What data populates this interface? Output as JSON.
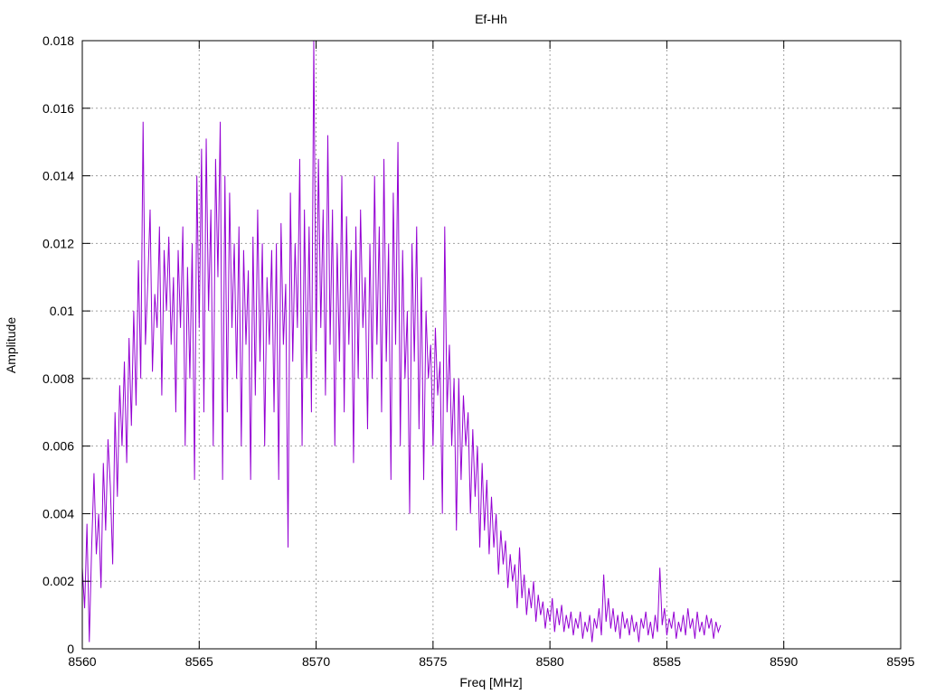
{
  "chart_data": {
    "type": "line",
    "title": "Ef-Hh",
    "xlabel": "Freq [MHz]",
    "ylabel": "Amplitude",
    "xlim": [
      8560,
      8595
    ],
    "ylim": [
      0,
      0.018
    ],
    "x_ticks": [
      "8560",
      "8565",
      "8570",
      "8575",
      "8580",
      "8585",
      "8590",
      "8595"
    ],
    "y_ticks": [
      "0",
      "0.002",
      "0.004",
      "0.006",
      "0.008",
      "0.01",
      "0.012",
      "0.014",
      "0.016",
      "0.018"
    ],
    "grid": true,
    "line_color": "#9400d3",
    "series": [
      {
        "x_start": 8560.0,
        "x_step": 0.1,
        "values": [
          0.0024,
          0.0012,
          0.0037,
          0.0002,
          0.003,
          0.0052,
          0.0028,
          0.004,
          0.0018,
          0.0055,
          0.0035,
          0.0062,
          0.0048,
          0.0025,
          0.007,
          0.0045,
          0.0078,
          0.006,
          0.0085,
          0.0055,
          0.0092,
          0.0066,
          0.01,
          0.0072,
          0.0115,
          0.008,
          0.0156,
          0.009,
          0.0108,
          0.013,
          0.0082,
          0.0105,
          0.0095,
          0.0125,
          0.0075,
          0.0118,
          0.01,
          0.0122,
          0.009,
          0.011,
          0.007,
          0.0118,
          0.0095,
          0.0125,
          0.006,
          0.0113,
          0.008,
          0.012,
          0.005,
          0.014,
          0.0095,
          0.0148,
          0.007,
          0.0151,
          0.01,
          0.013,
          0.006,
          0.0145,
          0.011,
          0.0156,
          0.005,
          0.014,
          0.007,
          0.0135,
          0.0095,
          0.012,
          0.008,
          0.0125,
          0.006,
          0.0118,
          0.009,
          0.0112,
          0.005,
          0.0122,
          0.0075,
          0.013,
          0.0085,
          0.012,
          0.006,
          0.011,
          0.009,
          0.0118,
          0.007,
          0.012,
          0.005,
          0.0126,
          0.009,
          0.0108,
          0.003,
          0.0135,
          0.0085,
          0.012,
          0.0095,
          0.0145,
          0.006,
          0.013,
          0.008,
          0.0125,
          0.007,
          0.018,
          0.0088,
          0.0145,
          0.0095,
          0.013,
          0.0075,
          0.0152,
          0.009,
          0.013,
          0.006,
          0.012,
          0.0085,
          0.014,
          0.007,
          0.0128,
          0.009,
          0.0118,
          0.0055,
          0.0125,
          0.008,
          0.013,
          0.0095,
          0.011,
          0.0065,
          0.012,
          0.008,
          0.014,
          0.009,
          0.0125,
          0.007,
          0.0145,
          0.0085,
          0.012,
          0.005,
          0.0135,
          0.009,
          0.015,
          0.006,
          0.0118,
          0.008,
          0.01,
          0.004,
          0.012,
          0.0085,
          0.0125,
          0.0065,
          0.011,
          0.005,
          0.01,
          0.008,
          0.009,
          0.006,
          0.0095,
          0.0075,
          0.0085,
          0.004,
          0.0125,
          0.007,
          0.009,
          0.006,
          0.008,
          0.0035,
          0.008,
          0.005,
          0.0075,
          0.006,
          0.007,
          0.004,
          0.0065,
          0.0045,
          0.006,
          0.003,
          0.0055,
          0.0035,
          0.005,
          0.0028,
          0.0045,
          0.003,
          0.004,
          0.0022,
          0.0035,
          0.0025,
          0.0032,
          0.0018,
          0.0028,
          0.002,
          0.0025,
          0.0012,
          0.003,
          0.0015,
          0.0022,
          0.001,
          0.0018,
          0.0012,
          0.002,
          0.0008,
          0.0016,
          0.001,
          0.0014,
          0.0006,
          0.0012,
          0.0008,
          0.0015,
          0.0005,
          0.0012,
          0.0007,
          0.0013,
          0.0005,
          0.001,
          0.0006,
          0.0011,
          0.0004,
          0.0009,
          0.0006,
          0.0011,
          0.0003,
          0.0008,
          0.0005,
          0.001,
          0.0002,
          0.0009,
          0.0006,
          0.0012,
          0.0004,
          0.0022,
          0.0008,
          0.0015,
          0.0006,
          0.0012,
          0.0005,
          0.001,
          0.0003,
          0.0011,
          0.0006,
          0.0009,
          0.0004,
          0.001,
          0.0005,
          0.0008,
          0.0002,
          0.0009,
          0.0006,
          0.0011,
          0.0004,
          0.0008,
          0.0003,
          0.001,
          0.0005,
          0.0024,
          0.0007,
          0.0012,
          0.0004,
          0.0009,
          0.0006,
          0.0011,
          0.0003,
          0.0008,
          0.0005,
          0.001,
          0.0004,
          0.0012,
          0.0006,
          0.0009,
          0.0003,
          0.0011,
          0.0005,
          0.0008,
          0.0004,
          0.001,
          0.0006,
          0.0009,
          0.0003,
          0.0008,
          0.0005,
          0.0007
        ]
      }
    ]
  }
}
